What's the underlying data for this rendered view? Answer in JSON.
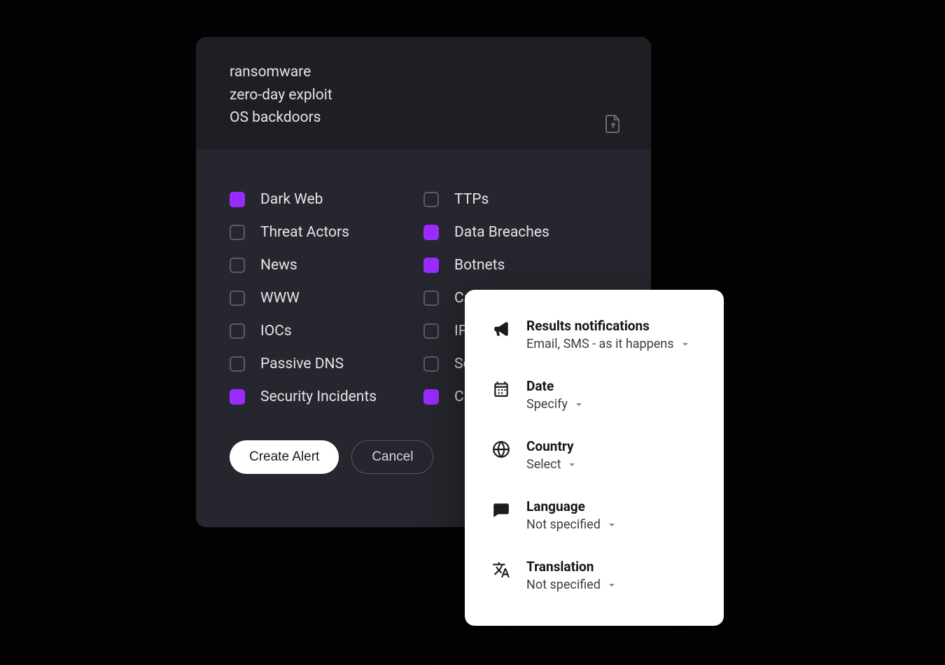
{
  "colors": {
    "accent": "#9a2bff"
  },
  "keywords": [
    "ransomware",
    "zero-day exploit",
    "OS backdoors"
  ],
  "categories": {
    "left": [
      {
        "label": "Dark Web",
        "checked": true
      },
      {
        "label": "Threat Actors",
        "checked": false
      },
      {
        "label": "News",
        "checked": false
      },
      {
        "label": "WWW",
        "checked": false
      },
      {
        "label": "IOCs",
        "checked": false
      },
      {
        "label": "Passive DNS",
        "checked": false
      },
      {
        "label": "Security Incidents",
        "checked": true
      }
    ],
    "right": [
      {
        "label": "TTPs",
        "checked": false
      },
      {
        "label": "Data Breaches",
        "checked": true
      },
      {
        "label": "Botnets",
        "checked": true
      },
      {
        "label": "Ca",
        "checked": false
      },
      {
        "label": "IP F",
        "checked": false
      },
      {
        "label": "Sec",
        "checked": false
      },
      {
        "label": "Car",
        "checked": true
      }
    ]
  },
  "actions": {
    "create": "Create Alert",
    "cancel": "Cancel"
  },
  "popover": {
    "notifications": {
      "title": "Results notifications",
      "value": "Email, SMS - as it happens"
    },
    "date": {
      "title": "Date",
      "value": "Specify"
    },
    "country": {
      "title": "Country",
      "value": "Select"
    },
    "language": {
      "title": "Language",
      "value": "Not specified"
    },
    "translation": {
      "title": "Translation",
      "value": "Not specified"
    }
  },
  "icons": {
    "upload": "upload-file-icon",
    "bullhorn": "bullhorn-icon",
    "calendar": "calendar-icon",
    "globe": "globe-icon",
    "chat": "chat-icon",
    "translate": "translate-icon",
    "chevron": "chevron-down-icon"
  }
}
